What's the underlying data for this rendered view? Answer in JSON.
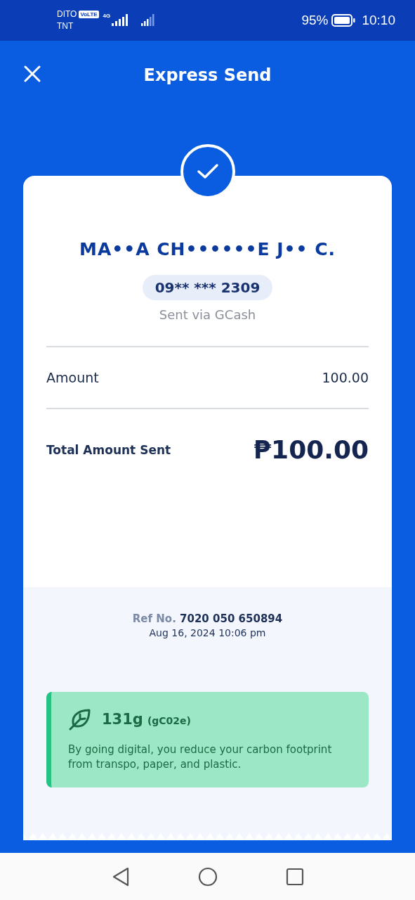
{
  "status_bar": {
    "carrier_1": "DITO",
    "volte_badge": "VoLTE",
    "network": "4G",
    "carrier_2": "TNT",
    "battery_percent": "95%",
    "time": "10:10"
  },
  "header": {
    "title": "Express Send"
  },
  "recipient": {
    "name": "MA••A CH••••••E J•• C.",
    "number": "09** *** 2309",
    "sent_via": "Sent via GCash"
  },
  "details": [
    {
      "label": "Amount",
      "value": "100.00"
    }
  ],
  "total": {
    "label": "Total Amount Sent",
    "value": "₱100.00"
  },
  "reference": {
    "label": "Ref No.",
    "number": "7020 050 650894",
    "date": "Aug 16, 2024 10:06 pm"
  },
  "carbon": {
    "amount": "131g",
    "unit": "(gC02e)",
    "message": "By going digital, you reduce your carbon footprint from transpo, paper, and plastic."
  }
}
